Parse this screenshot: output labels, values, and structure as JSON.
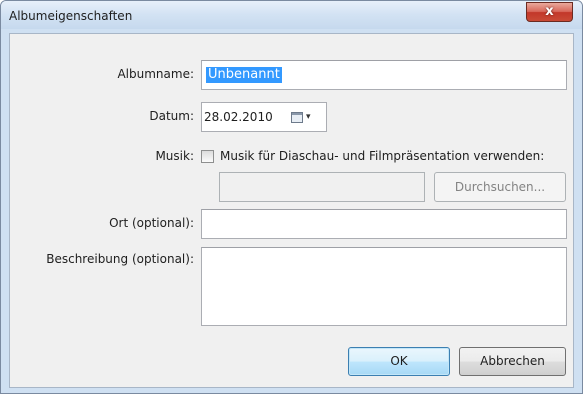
{
  "window": {
    "title": "Albumeigenschaften",
    "close_glyph": "x"
  },
  "form": {
    "albumname": {
      "label": "Albumname:",
      "value": "Unbenannt"
    },
    "datum": {
      "label": "Datum:",
      "value": "28.02.2010",
      "icon": "calendar-icon",
      "dropdown_glyph": "▾"
    },
    "musik": {
      "label": "Musik:",
      "checkbox_label": "Musik für Diaschau- und Filmpräsentation verwenden:",
      "checked": false,
      "path_value": "",
      "browse_label": "Durchsuchen..."
    },
    "ort": {
      "label": "Ort (optional):",
      "value": ""
    },
    "beschreibung": {
      "label": "Beschreibung (optional):",
      "value": ""
    }
  },
  "buttons": {
    "ok": "OK",
    "cancel": "Abbrechen"
  },
  "colors": {
    "selection": "#3399ff",
    "close_button": "#c94a36",
    "frame": "#cfe0f2",
    "panel": "#f0f0f0"
  }
}
